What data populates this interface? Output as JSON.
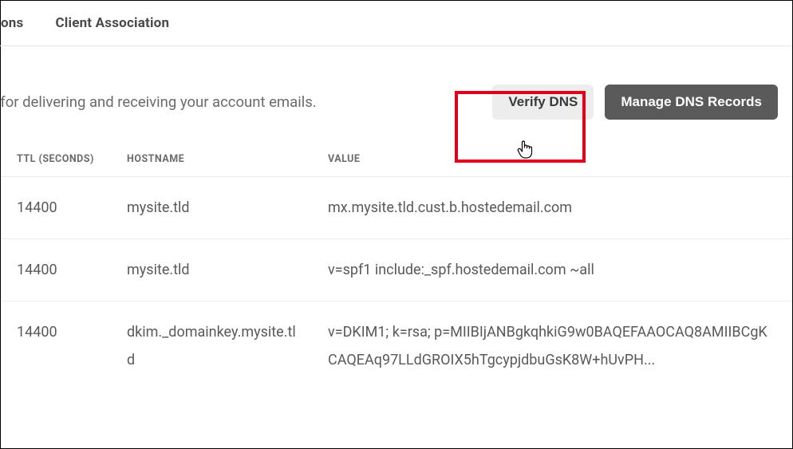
{
  "tabs": {
    "items": [
      {
        "label": "ons"
      },
      {
        "label": "Client Association"
      }
    ]
  },
  "description": "ble for delivering and receiving your account emails.",
  "buttons": {
    "verify": "Verify DNS",
    "manage": "Manage DNS Records"
  },
  "table": {
    "headers": {
      "ttl": "TTL (SECONDS)",
      "hostname": "HOSTNAME",
      "value": "VALUE"
    },
    "rows": [
      {
        "ttl": "14400",
        "hostname": "mysite.tld",
        "value": "mx.mysite.tld.cust.b.hostedemail.com"
      },
      {
        "ttl": "14400",
        "hostname": "mysite.tld",
        "value": "v=spf1 include:_spf.hostedemail.com ~all"
      },
      {
        "ttl": "14400",
        "hostname": "dkim._domainkey.mysite.tld",
        "value": "v=DKIM1; k=rsa; p=MIIBIjANBgkqhkiG9w0BAQEFAAOCAQ8AMIIBCgKCAQEAq97LLdGROIX5hTgcypjdbuGsK8W+hUvPH..."
      }
    ]
  }
}
